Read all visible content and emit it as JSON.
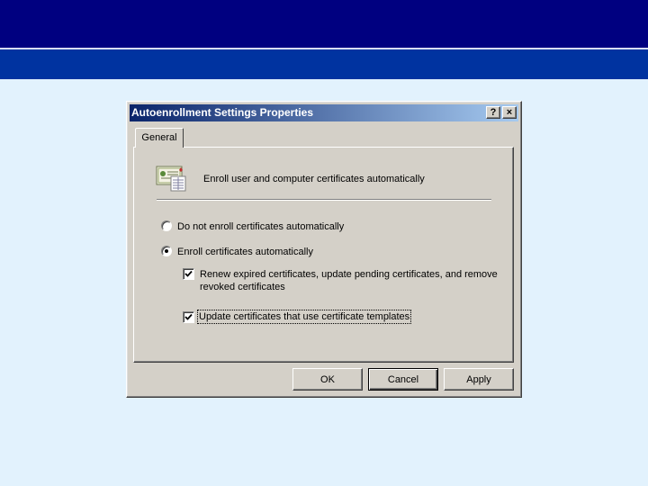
{
  "dialog": {
    "title": "Autoenrollment Settings Properties",
    "help_glyph": "?",
    "close_glyph": "×"
  },
  "tabs": [
    {
      "label": "General",
      "selected": true
    }
  ],
  "general": {
    "icon": "certificate-icon",
    "heading": "Enroll user and computer certificates automatically",
    "options": {
      "do_not_enroll": {
        "label": "Do not enroll certificates automatically",
        "checked": false
      },
      "enroll": {
        "label": "Enroll certificates automatically",
        "checked": true
      }
    },
    "renew": {
      "line1": "Renew expired certificates, update pending certificates, and remove",
      "line2": "revoked certificates",
      "checked": true
    },
    "update_templates": {
      "label": "Update certificates that use certificate templates",
      "checked": true
    }
  },
  "buttons": {
    "ok": "OK",
    "cancel": "Cancel",
    "apply": "Apply"
  },
  "colors": {
    "desktop_background": "#e2f2fd",
    "top_band": "#000080",
    "second_band": "#0033a0",
    "dialog_face": "#d4d0c8",
    "title_gradient_start": "#0a246a",
    "title_gradient_end": "#a6caf0"
  }
}
